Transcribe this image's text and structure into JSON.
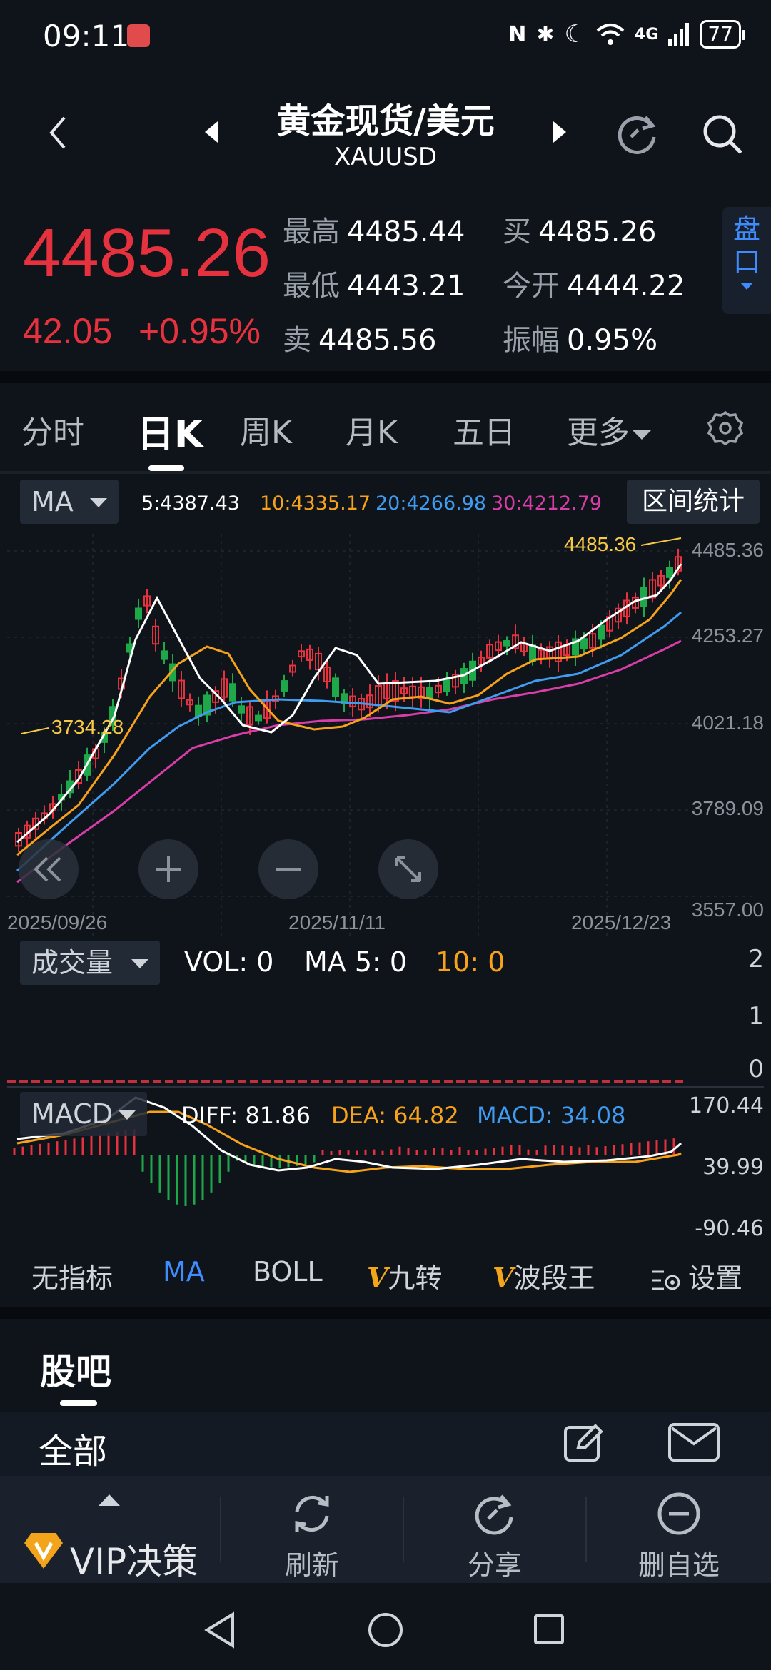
{
  "status_bar": {
    "time": "09:11",
    "network": "4G",
    "battery": "77"
  },
  "header": {
    "title": "黄金现货/美元",
    "subtitle": "XAUUSD"
  },
  "quote": {
    "price": "4485.26",
    "change": "42.05",
    "change_pct": "+0.95%",
    "high_label": "最高",
    "high": "4485.44",
    "low_label": "最低",
    "low": "4443.21",
    "sell_label": "卖",
    "sell": "4485.56",
    "buy_label": "买",
    "buy": "4485.26",
    "open_label": "今开",
    "open": "4444.22",
    "amp_label": "振幅",
    "amp": "0.95%",
    "pankou_line1": "盘",
    "pankou_line2": "口"
  },
  "tabs": [
    {
      "label": "分时"
    },
    {
      "label": "日K"
    },
    {
      "label": "周K"
    },
    {
      "label": "月K"
    },
    {
      "label": "五日"
    },
    {
      "label": "更多"
    }
  ],
  "ma_row": {
    "selector": "MA",
    "ma5": "5:4387.43",
    "ma10": "10:4335.17",
    "ma20": "20:4266.98",
    "ma30": "30:4212.79",
    "range_stats": "区间统计"
  },
  "chart": {
    "y_labels": [
      "4485.36",
      "4253.27",
      "4021.18",
      "3789.09",
      "3557.00"
    ],
    "x_labels": [
      "2025/09/26",
      "2025/11/11",
      "2025/12/23"
    ],
    "high_marker": "4485.36",
    "low_marker": "3734.28"
  },
  "volume": {
    "selector": "成交量",
    "vol": "VOL: 0",
    "ma5": "MA 5: 0",
    "ma10": "10: 0",
    "y_labels": [
      "2",
      "1",
      "0"
    ]
  },
  "macd": {
    "selector": "MACD",
    "diff": "DIFF: 81.86",
    "dea": "DEA: 64.82",
    "macd": "MACD: 34.08",
    "y_labels": [
      "170.44",
      "39.99",
      "-90.46"
    ]
  },
  "indicators": [
    {
      "label": "无指标"
    },
    {
      "label": "MA"
    },
    {
      "label": "BOLL"
    },
    {
      "label": "九转"
    },
    {
      "label": "波段王"
    },
    {
      "label": "设置"
    }
  ],
  "guba": {
    "title": "股吧",
    "all_label": "全部"
  },
  "bottom_bar": [
    {
      "label": "VIP决策"
    },
    {
      "label": "刷新"
    },
    {
      "label": "分享"
    },
    {
      "label": "删自选"
    }
  ],
  "colors": {
    "up": "#e5323e",
    "down": "#1fa84a",
    "ma5": "#ffffff",
    "ma10": "#f7a21b",
    "ma20": "#3f9cf0",
    "ma30": "#d93da8",
    "accent": "#3f8cff"
  }
}
